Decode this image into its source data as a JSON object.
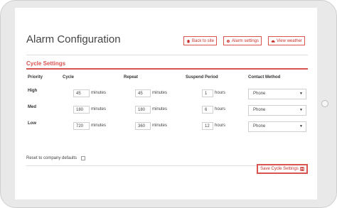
{
  "header": {
    "title": "Alarm Configuration",
    "buttons": [
      {
        "label": "Back to site",
        "icon": "home-icon"
      },
      {
        "label": "Alarm settings",
        "icon": "cogs-icon"
      },
      {
        "label": "View weather",
        "icon": "cloud-icon"
      }
    ]
  },
  "section": {
    "title": "Cycle Settings"
  },
  "table": {
    "columns": [
      "Priority",
      "Cycle",
      "Repeat",
      "Suspend Period",
      "Contact Method"
    ],
    "rows": [
      {
        "priority": "High",
        "cycle": "45",
        "cycle_unit": "minutes",
        "repeat": "45",
        "repeat_unit": "minutes",
        "suspend": "1",
        "suspend_unit": "hours",
        "contact": "Phone"
      },
      {
        "priority": "Med",
        "cycle": "180",
        "cycle_unit": "minutes",
        "repeat": "180",
        "repeat_unit": "minutes",
        "suspend": "6",
        "suspend_unit": "hours",
        "contact": "Phone"
      },
      {
        "priority": "Low",
        "cycle": "720",
        "cycle_unit": "minutes",
        "repeat": "360",
        "repeat_unit": "minutes",
        "suspend": "12",
        "suspend_unit": "hours",
        "contact": "Phone"
      }
    ]
  },
  "reset": {
    "label": "Reset to company defaults",
    "checked": false
  },
  "save": {
    "label": "Save Cycle Settings",
    "icon": "save-icon"
  },
  "colors": {
    "accent": "#d9534f",
    "border": "#cfcfcf",
    "bezel": "#e9e9e9"
  }
}
